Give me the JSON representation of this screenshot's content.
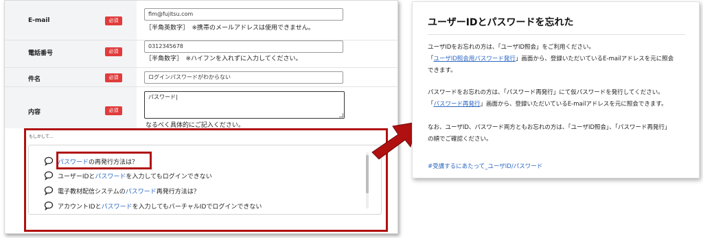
{
  "form": {
    "required_badge": "必須",
    "email": {
      "label": "E-mail",
      "value": "flm@fujitsu.com",
      "note": "［半角英数字］　※携帯のメールアドレスは使用できません。"
    },
    "phone": {
      "label": "電話番号",
      "value": "0312345678",
      "note": "［半角数字］　※ハイフンを入れずに入力してください。"
    },
    "subject": {
      "label": "件名",
      "value": "ログインパスワードがわからない"
    },
    "content": {
      "label": "内容",
      "value": "パスワード|",
      "note": "なるべく具体的にご記入ください。"
    }
  },
  "suggestions": {
    "caption": "もしかして…",
    "items": [
      {
        "highlight": "パスワード",
        "pre": "",
        "post": "の再発行方法は？"
      },
      {
        "pre": "ユーザーIDと",
        "highlight": "パスワード",
        "post": "を入力してもログインできない"
      },
      {
        "pre": "電子教材配信システムの",
        "highlight": "パスワード",
        "post": "再発行方法は？"
      },
      {
        "pre": "アカウントIDと",
        "highlight": "パスワード",
        "post": "を入力してもバーチャルIDでログインできない"
      }
    ]
  },
  "help": {
    "title": "ユーザーIDとパスワードを忘れた",
    "p1_line1": "ユーザIDをお忘れの方は、「ユーザID照会」をご利用ください。",
    "p1_line2_pre": "「",
    "p1_link": "ユーザID照会用パスワード発行",
    "p1_line2_post": "」画面から、登録いただいているE-mailアドレスを元に照会",
    "p1_line3": "できます。",
    "p2_line1": "パスワードをお忘れの方は、「パスワード再発行」にて仮パスワードを発行してください。",
    "p2_line2_pre": "「",
    "p2_link": "パスワード再発行",
    "p2_line2_post": "」画面から、登録いただいているE-mailアドレスを元に照会できます。",
    "p3_line1": "なお、ユーザID、パスワード両方ともお忘れの方は、「ユーザID照会」、「パスワード再発行」",
    "p3_line2": "の順でご確認ください。",
    "tag": "#受講するにあたって_ユーザID/パスワード"
  },
  "colors": {
    "accent_red": "#b01010",
    "link_blue": "#2a66c2",
    "badge_red": "#e03c3c"
  }
}
